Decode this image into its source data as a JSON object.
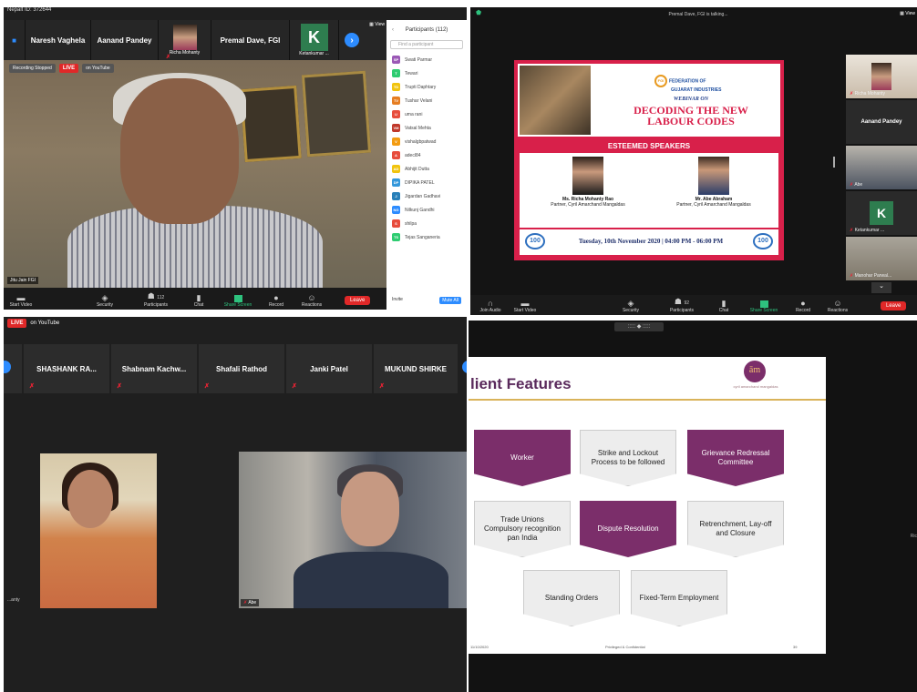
{
  "q1": {
    "meeting_id": "Nepalt ID: 372644",
    "top_left_badge": "■",
    "thumbs": [
      {
        "name": "Naresh Vaghela"
      },
      {
        "name": "Aanand Pandey"
      },
      {
        "name": "Richa Mohanty"
      },
      {
        "name": "Premal Dave, FGI"
      },
      {
        "name": "Ketankumar ..."
      }
    ],
    "k_letter": "K",
    "next_arrow": "›",
    "view_label": "View",
    "recording_label": "Recording Stopped",
    "live_label": "LIVE",
    "youtube_label": "on YouTube",
    "speaker_name": "Jitu Jain FGI",
    "participants": {
      "back": "‹",
      "title": "Participants (112)",
      "search_placeholder": "Find a participant",
      "list": [
        {
          "initials": "SP",
          "name": "Swati Parmar",
          "color": "#9b59b6"
        },
        {
          "initials": "T",
          "name": "Tewari",
          "color": "#2ecc71"
        },
        {
          "initials": "TD",
          "name": "Trupti Daphtary",
          "color": "#f1c40f"
        },
        {
          "initials": "TV",
          "name": "Tushar Velani",
          "color": "#e67e22"
        },
        {
          "initials": "U",
          "name": "uma rani",
          "color": "#e74c3c"
        },
        {
          "initials": "VM",
          "name": "Vatsal Mehta",
          "color": "#c0392b"
        },
        {
          "initials": "V",
          "name": "vishalgbpatwad",
          "color": "#f39c12"
        },
        {
          "initials": "A",
          "name": "adecl84",
          "color": "#e74c3c"
        },
        {
          "initials": "AD",
          "name": "Abhijit Dutta",
          "color": "#f1c40f"
        },
        {
          "initials": "DP",
          "name": "DIPIKA PATEL",
          "color": "#3498db"
        },
        {
          "initials": "J",
          "name": "Jigardan Gadhavi",
          "color": "#2980b9"
        },
        {
          "initials": "NG",
          "name": "Nilkunj Gandhi",
          "color": "#2d8cff"
        },
        {
          "initials": "S",
          "name": "shilpa",
          "color": "#e74c3c"
        },
        {
          "initials": "TS",
          "name": "Tejas Sanganeria",
          "color": "#2ecc71"
        }
      ],
      "invite": "Invite",
      "mute_all": "Mute All"
    },
    "toolbar": {
      "start_video": "Start Video",
      "security": "Security",
      "participants": "Participants",
      "participants_count": "112",
      "chat": "Chat",
      "share_screen": "Share Screen",
      "record": "Record",
      "reactions": "Reactions",
      "leave": "Leave"
    }
  },
  "q2": {
    "talking": "Premal Dave, FGI is talking...",
    "view": "View",
    "slide": {
      "fgi_line1": "FEDERATION OF",
      "fgi_line2": "GUJARAT INDUSTRIES",
      "fgi_mark": "FGI",
      "webinar_on": "WEBINAR ON",
      "title_line1": "DECODING THE NEW",
      "title_line2": "LABOUR CODES",
      "esteemed": "ESTEEMED SPEAKERS",
      "speaker1_name": "Ms. Richa Mohanty Rao",
      "speaker1_role": "Partner, Cyril Amarchand Mangaldas",
      "speaker2_name": "Mr. Abe Abraham",
      "speaker2_role": "Partner, Cyril Amarchand Mangaldas",
      "years": "100",
      "date": "Tuesday, 10th November 2020 | 04:00 PM - 06:00 PM"
    },
    "side": [
      {
        "label": "Richa Mohanty",
        "text": ""
      },
      {
        "label": "",
        "text": "Aanand Pandey"
      },
      {
        "label": "Abe",
        "text": ""
      },
      {
        "label": "Ketankumar ...",
        "text": "K"
      },
      {
        "label": "Manohar Parwal...",
        "text": ""
      }
    ],
    "caret": "⌄",
    "toolbar": {
      "join_audio": "Join Audio",
      "start_video": "Start Video",
      "security": "Security",
      "participants": "Participants",
      "participants_count": "92",
      "chat": "Chat",
      "share_screen": "Share Screen",
      "record": "Record",
      "reactions": "Reactions",
      "leave": "Leave"
    }
  },
  "q3": {
    "live_label": "LIVE",
    "youtube_label": "on YouTube",
    "tiles": [
      {
        "name": "SHASHANK RA..."
      },
      {
        "name": "Shabnam Kachw..."
      },
      {
        "name": "Shafali Rathod"
      },
      {
        "name": "Janki Patel"
      },
      {
        "name": "MUKUND SHIRKE"
      }
    ],
    "woman_name": "...anty",
    "man_name": "Abe"
  },
  "q4": {
    "slide": {
      "title": "lient Features",
      "logo": "ām",
      "logo_sub": "cyril amarchand mangaldas",
      "features": [
        {
          "text": "Worker",
          "style": "p"
        },
        {
          "text": "Strike and Lockout Process to be followed",
          "style": "w"
        },
        {
          "text": "Grievance Redressal Committee",
          "style": "p"
        },
        {
          "text": "Trade Unions Compulsory recognition pan India",
          "style": "w"
        },
        {
          "text": "Dispute Resolution",
          "style": "p"
        },
        {
          "text": "Retrenchment, Lay-off and Closure",
          "style": "w"
        },
        {
          "text": "Standing Orders",
          "style": "w"
        },
        {
          "text": "Fixed-Term Employment",
          "style": "w"
        }
      ],
      "foot_left": "11/10/2020",
      "foot_center": "Privileged & Confidential",
      "foot_right": "39"
    },
    "zoom_label": "::::: ◆ :::::",
    "side_label": "Ric"
  }
}
